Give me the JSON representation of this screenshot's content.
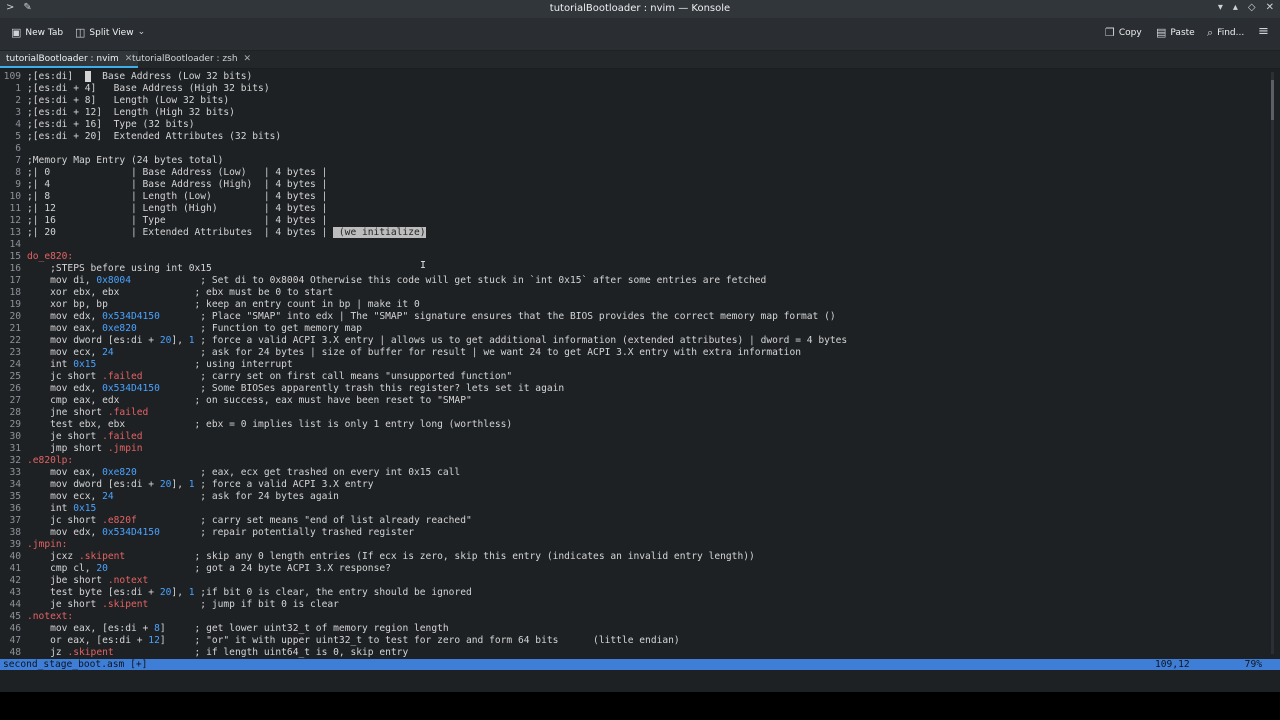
{
  "window": {
    "title": "tutorialBootloader : nvim — Konsole",
    "controls": [
      "▾",
      "▴",
      "◇",
      "✕"
    ]
  },
  "toolbar": {
    "new_tab": "New Tab",
    "split_view": "Split View",
    "copy": "Copy",
    "paste": "Paste",
    "find": "Find..."
  },
  "tabs": [
    {
      "label": "tutorialBootloader : nvim",
      "active": true
    },
    {
      "label": "tutorialBootloader : zsh",
      "active": false
    }
  ],
  "editor": {
    "lines": [
      {
        "n": "109",
        "segs": [
          {
            "t": ";[es:di]  "
          },
          {
            "t": " ",
            "c": "cursor"
          },
          {
            "t": "  Base Address (Low 32 bits)"
          }
        ]
      },
      {
        "n": "1",
        "segs": [
          {
            "t": ";[es:di + 4]   Base Address (High 32 bits)"
          }
        ]
      },
      {
        "n": "2",
        "segs": [
          {
            "t": ";[es:di + 8]   Length (Low 32 bits)"
          }
        ]
      },
      {
        "n": "3",
        "segs": [
          {
            "t": ";[es:di + 12]  Length (High 32 bits)"
          }
        ]
      },
      {
        "n": "4",
        "segs": [
          {
            "t": ";[es:di + 16]  Type (32 bits)"
          }
        ]
      },
      {
        "n": "5",
        "segs": [
          {
            "t": ";[es:di + 20]  Extended Attributes (32 bits)"
          }
        ]
      },
      {
        "n": "6",
        "segs": []
      },
      {
        "n": "7",
        "segs": [
          {
            "t": ";Memory Map Entry (24 bytes total)"
          }
        ]
      },
      {
        "n": "8",
        "segs": [
          {
            "t": ";| 0              | Base Address (Low)   | 4 bytes |"
          }
        ]
      },
      {
        "n": "9",
        "segs": [
          {
            "t": ";| 4              | Base Address (High)  | 4 bytes |"
          }
        ]
      },
      {
        "n": "10",
        "segs": [
          {
            "t": ";| 8              | Length (Low)         | 4 bytes |"
          }
        ]
      },
      {
        "n": "11",
        "segs": [
          {
            "t": ";| 12             | Length (High)        | 4 bytes |"
          }
        ]
      },
      {
        "n": "12",
        "segs": [
          {
            "t": ";| 16             | Type                 | 4 bytes |"
          }
        ]
      },
      {
        "n": "13",
        "segs": [
          {
            "t": ";| 20             | Extended Attributes  | 4 bytes | "
          },
          {
            "t": " (we initialize)",
            "c": "sel"
          }
        ]
      },
      {
        "n": "14",
        "segs": []
      },
      {
        "n": "15",
        "segs": [
          {
            "t": "do_e820:",
            "c": "lbl"
          }
        ]
      },
      {
        "n": "16",
        "segs": [
          {
            "t": "    ;STEPS before using int 0x15"
          }
        ]
      },
      {
        "n": "17",
        "segs": [
          {
            "t": "    mov di, "
          },
          {
            "t": "0x8004",
            "c": "num"
          },
          {
            "t": "            ; Set di to 0x8004 Otherwise this code will get stuck in `int 0x15` after some entries are fetched"
          }
        ]
      },
      {
        "n": "18",
        "segs": [
          {
            "t": "    xor ebx, ebx             ; ebx must be 0 to start"
          }
        ]
      },
      {
        "n": "19",
        "segs": [
          {
            "t": "    xor bp, bp               ; keep an entry count in bp | make it 0"
          }
        ]
      },
      {
        "n": "20",
        "segs": [
          {
            "t": "    mov edx, "
          },
          {
            "t": "0x534D4150",
            "c": "num"
          },
          {
            "t": "       ; Place \"SMAP\" into edx | The \"SMAP\" signature ensures that the BIOS provides the correct memory map format ()"
          }
        ]
      },
      {
        "n": "21",
        "segs": [
          {
            "t": "    mov eax, "
          },
          {
            "t": "0xe820",
            "c": "num"
          },
          {
            "t": "           ; Function to get memory map"
          }
        ]
      },
      {
        "n": "22",
        "segs": [
          {
            "t": "    mov dword [es:di + "
          },
          {
            "t": "20",
            "c": "num"
          },
          {
            "t": "], "
          },
          {
            "t": "1",
            "c": "num"
          },
          {
            "t": " ; force a valid ACPI 3.X entry | allows us to get additional information (extended attributes) | dword = 4 bytes"
          }
        ]
      },
      {
        "n": "23",
        "segs": [
          {
            "t": "    mov ecx, "
          },
          {
            "t": "24",
            "c": "num"
          },
          {
            "t": "               ; ask for 24 bytes | size of buffer for result | we want 24 to get ACPI 3.X entry with extra information"
          }
        ]
      },
      {
        "n": "24",
        "segs": [
          {
            "t": "    int "
          },
          {
            "t": "0x15",
            "c": "num"
          },
          {
            "t": "                 ; using interrupt"
          }
        ]
      },
      {
        "n": "25",
        "segs": [
          {
            "t": "    jc short "
          },
          {
            "t": ".failed",
            "c": "lbl"
          },
          {
            "t": "          ; carry set on first call means \"unsupported function\""
          }
        ]
      },
      {
        "n": "26",
        "segs": [
          {
            "t": "    mov edx, "
          },
          {
            "t": "0x534D4150",
            "c": "num"
          },
          {
            "t": "       ; Some BIOSes apparently trash this register? lets set it again"
          }
        ]
      },
      {
        "n": "27",
        "segs": [
          {
            "t": "    cmp eax, edx             ; on success, eax must have been reset to \"SMAP\""
          }
        ]
      },
      {
        "n": "28",
        "segs": [
          {
            "t": "    jne short "
          },
          {
            "t": ".failed",
            "c": "lbl"
          }
        ]
      },
      {
        "n": "29",
        "segs": [
          {
            "t": "    test ebx, ebx            ; ebx = 0 implies list is only 1 entry long (worthless)"
          }
        ]
      },
      {
        "n": "30",
        "segs": [
          {
            "t": "    je short "
          },
          {
            "t": ".failed",
            "c": "lbl"
          }
        ]
      },
      {
        "n": "31",
        "segs": [
          {
            "t": "    jmp short "
          },
          {
            "t": ".jmpin",
            "c": "lbl"
          }
        ]
      },
      {
        "n": "32",
        "segs": [
          {
            "t": ".e820lp:",
            "c": "lbl"
          }
        ]
      },
      {
        "n": "33",
        "segs": [
          {
            "t": "    mov eax, "
          },
          {
            "t": "0xe820",
            "c": "num"
          },
          {
            "t": "           ; eax, ecx get trashed on every int 0x15 call"
          }
        ]
      },
      {
        "n": "34",
        "segs": [
          {
            "t": "    mov dword [es:di + "
          },
          {
            "t": "20",
            "c": "num"
          },
          {
            "t": "], "
          },
          {
            "t": "1",
            "c": "num"
          },
          {
            "t": " ; force a valid ACPI 3.X entry"
          }
        ]
      },
      {
        "n": "35",
        "segs": [
          {
            "t": "    mov ecx, "
          },
          {
            "t": "24",
            "c": "num"
          },
          {
            "t": "               ; ask for 24 bytes again"
          }
        ]
      },
      {
        "n": "36",
        "segs": [
          {
            "t": "    int "
          },
          {
            "t": "0x15",
            "c": "num"
          }
        ]
      },
      {
        "n": "37",
        "segs": [
          {
            "t": "    jc short "
          },
          {
            "t": ".e820f",
            "c": "lbl"
          },
          {
            "t": "           ; carry set means \"end of list already reached\""
          }
        ]
      },
      {
        "n": "38",
        "segs": [
          {
            "t": "    mov edx, "
          },
          {
            "t": "0x534D4150",
            "c": "num"
          },
          {
            "t": "       ; repair potentially trashed register"
          }
        ]
      },
      {
        "n": "39",
        "segs": [
          {
            "t": ".jmpin:",
            "c": "lbl"
          }
        ]
      },
      {
        "n": "40",
        "segs": [
          {
            "t": "    jcxz "
          },
          {
            "t": ".skipent",
            "c": "lbl"
          },
          {
            "t": "            ; skip any 0 length entries (If ecx is zero, skip this entry (indicates an invalid entry length))"
          }
        ]
      },
      {
        "n": "41",
        "segs": [
          {
            "t": "    cmp cl, "
          },
          {
            "t": "20",
            "c": "num"
          },
          {
            "t": "               ; got a 24 byte ACPI 3.X response?"
          }
        ]
      },
      {
        "n": "42",
        "segs": [
          {
            "t": "    jbe short "
          },
          {
            "t": ".notext",
            "c": "lbl"
          }
        ]
      },
      {
        "n": "43",
        "segs": [
          {
            "t": "    test byte [es:di + "
          },
          {
            "t": "20",
            "c": "num"
          },
          {
            "t": "], "
          },
          {
            "t": "1",
            "c": "num"
          },
          {
            "t": " ;if bit 0 is clear, the entry should be ignored"
          }
        ]
      },
      {
        "n": "44",
        "segs": [
          {
            "t": "    je short "
          },
          {
            "t": ".skipent",
            "c": "lbl"
          },
          {
            "t": "         ; jump if bit 0 is clear"
          }
        ]
      },
      {
        "n": "45",
        "segs": [
          {
            "t": ".notext:",
            "c": "lbl"
          }
        ]
      },
      {
        "n": "46",
        "segs": [
          {
            "t": "    mov eax, [es:di + "
          },
          {
            "t": "8",
            "c": "num"
          },
          {
            "t": "]     ; get lower uint32_t of memory region length"
          }
        ]
      },
      {
        "n": "47",
        "segs": [
          {
            "t": "    or eax, [es:di + "
          },
          {
            "t": "12",
            "c": "num"
          },
          {
            "t": "]     ; \"or\" it with upper uint32_t to test for zero and form 64 bits      (little endian)"
          }
        ]
      },
      {
        "n": "48",
        "segs": [
          {
            "t": "    jz "
          },
          {
            "t": ".skipent",
            "c": "lbl"
          },
          {
            "t": "              ; if length uint64_t is 0, skip entry"
          }
        ]
      }
    ]
  },
  "status": {
    "file": "second_stage_boot.asm [+]",
    "position": "109,12",
    "percent": "79%"
  }
}
